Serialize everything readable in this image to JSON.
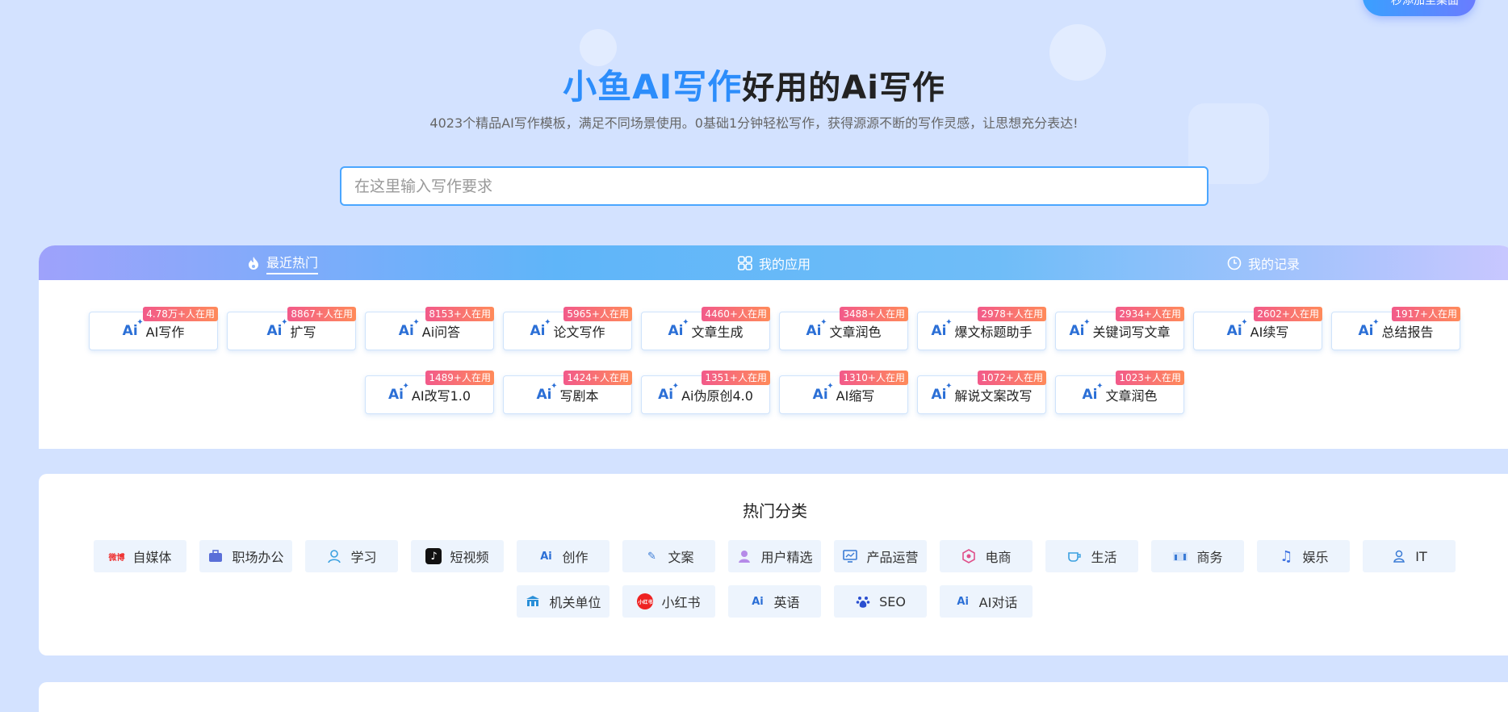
{
  "corner_button": "一秒添加至桌面",
  "hero": {
    "brand": "小鱼AI写作",
    "title_rest": "好用的Ai写作",
    "subtitle": "4023个精品AI写作模板，满足不同场景使用。0基础1分钟轻松写作，获得源源不断的写作灵感，让思想充分表达!"
  },
  "search": {
    "placeholder": "在这里输入写作要求"
  },
  "tabs": [
    {
      "label": "最近热门",
      "icon": "flame-icon"
    },
    {
      "label": "我的应用",
      "icon": "grid-icon"
    },
    {
      "label": "我的记录",
      "icon": "clock-icon"
    }
  ],
  "apps": [
    {
      "label": "AI写作",
      "badge": "4.78万+人在用"
    },
    {
      "label": "扩写",
      "badge": "8867+人在用"
    },
    {
      "label": "Ai问答",
      "badge": "8153+人在用"
    },
    {
      "label": "论文写作",
      "badge": "5965+人在用"
    },
    {
      "label": "文章生成",
      "badge": "4460+人在用"
    },
    {
      "label": "文章润色",
      "badge": "3488+人在用"
    },
    {
      "label": "爆文标题助手",
      "badge": "2978+人在用"
    },
    {
      "label": "关键词写文章",
      "badge": "2934+人在用"
    },
    {
      "label": "AI续写",
      "badge": "2602+人在用"
    },
    {
      "label": "总结报告",
      "badge": "1917+人在用"
    },
    {
      "label": "AI改写1.0",
      "badge": "1489+人在用"
    },
    {
      "label": "写剧本",
      "badge": "1424+人在用"
    },
    {
      "label": "Ai伪原创4.0",
      "badge": "1351+人在用"
    },
    {
      "label": "AI缩写",
      "badge": "1310+人在用"
    },
    {
      "label": "解说文案改写",
      "badge": "1072+人在用"
    },
    {
      "label": "文章润色",
      "badge": "1023+人在用"
    }
  ],
  "categories_title": "热门分类",
  "categories": [
    {
      "label": "自媒体",
      "icon": "media-logos-icon",
      "color": "#e33"
    },
    {
      "label": "职场办公",
      "icon": "briefcase-icon",
      "color": "#5a6fd8"
    },
    {
      "label": "学习",
      "icon": "person-icon",
      "color": "#3aa0e0"
    },
    {
      "label": "短视频",
      "icon": "tiktok-icon",
      "color": "#111"
    },
    {
      "label": "创作",
      "icon": "ai-icon",
      "color": "#2b6fd6"
    },
    {
      "label": "文案",
      "icon": "pen-icon",
      "color": "#3a7bd5"
    },
    {
      "label": "用户精选",
      "icon": "user-icon",
      "color": "#a070e0"
    },
    {
      "label": "产品运营",
      "icon": "monitor-icon",
      "color": "#3a7bd5"
    },
    {
      "label": "电商",
      "icon": "shop-icon",
      "color": "#e0508a"
    },
    {
      "label": "生活",
      "icon": "cup-icon",
      "color": "#3aa0e0"
    },
    {
      "label": "商务",
      "icon": "business-icon",
      "color": "#3a7bd5"
    },
    {
      "label": "娱乐",
      "icon": "music-icon",
      "color": "#3a6fe0"
    },
    {
      "label": "IT",
      "icon": "engineer-icon",
      "color": "#3a7bd5"
    },
    {
      "label": "机关单位",
      "icon": "building-icon",
      "color": "#2a8fd8"
    },
    {
      "label": "小红书",
      "icon": "xiaohongshu-icon",
      "color": "#e22"
    },
    {
      "label": "英语",
      "icon": "ai-icon",
      "color": "#2b6fd6"
    },
    {
      "label": "SEO",
      "icon": "paw-icon",
      "color": "#2a4fd0"
    },
    {
      "label": "AI对话",
      "icon": "ai-icon",
      "color": "#2b6fd6"
    }
  ]
}
